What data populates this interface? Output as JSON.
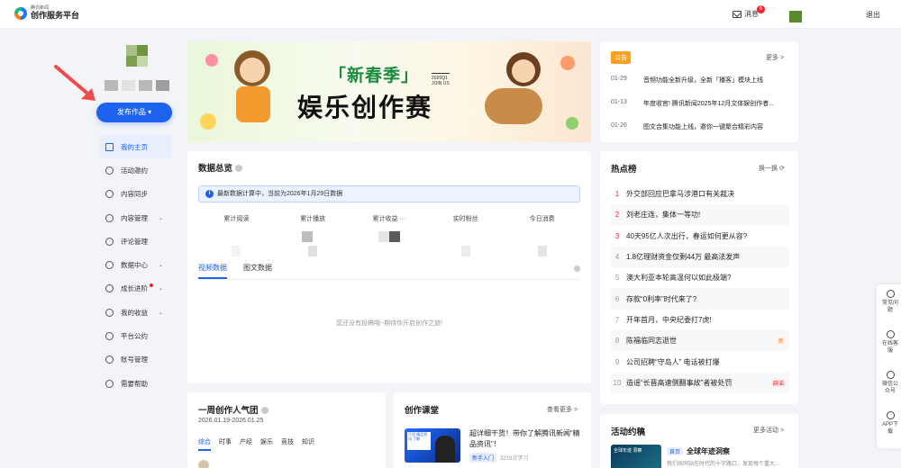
{
  "header": {
    "logo_small": "腾讯新闻",
    "logo_main": "创作服务平台",
    "messages_label": "消息",
    "messages_count": "6",
    "logout_label": "退出"
  },
  "sidebar": {
    "publish_label": "发布作品 ▾",
    "items": [
      {
        "label": "我的主页",
        "icon": "home-icon",
        "active": true
      },
      {
        "label": "活动邀约",
        "icon": "activity-icon"
      },
      {
        "label": "内容同步",
        "icon": "sync-icon"
      },
      {
        "label": "内容管理",
        "icon": "content-icon",
        "expand": true
      },
      {
        "label": "评论管理",
        "icon": "comment-icon"
      },
      {
        "label": "数据中心",
        "icon": "data-icon",
        "expand": true
      },
      {
        "label": "成长进阶",
        "icon": "growth-icon",
        "expand": true,
        "dot": true
      },
      {
        "label": "我的收益",
        "icon": "income-icon",
        "expand": true
      },
      {
        "label": "平台公约",
        "icon": "rules-icon"
      },
      {
        "label": "账号管理",
        "icon": "account-icon"
      },
      {
        "label": "需要帮助",
        "icon": "help-icon"
      }
    ]
  },
  "banner": {
    "title_small": "新春季",
    "title_big": "娱乐创作赛",
    "quarter": "2026Q1",
    "join": "JOIN US"
  },
  "overview": {
    "title": "数据总览",
    "notice": "最新数据计算中，当前为2026年1月29日数据",
    "stats": [
      "累计阅读",
      "累计播放",
      "累计收益 ···",
      "实时粉丝",
      "今日消费"
    ],
    "tabs": [
      "视频数据",
      "图文数据"
    ],
    "empty": "您还没有投稿哦~期待你开启创作之旅!"
  },
  "week": {
    "title": "一周创作人气团",
    "date": "2026.01.19-2026.01.25",
    "tabs": [
      "综合",
      "时事",
      "产经",
      "娱乐",
      "竞技",
      "知识"
    ]
  },
  "course": {
    "title": "创作课堂",
    "more": "查看更多 >",
    "item_title": "超详细干货！带你了解腾讯新闻“精品资讯”！",
    "item_tag": "新手入门",
    "item_count": "3219次学习",
    "thumb_text": "干货 精品资讯 了解"
  },
  "announce": {
    "tag": "公告",
    "more": "更多 >",
    "items": [
      {
        "date": "01-29",
        "text": "音频功能全新升级，全新「播客」模块上线"
      },
      {
        "date": "01-13",
        "text": "年度收官! 腾讯新闻2025年12月文体娱创作者..."
      },
      {
        "date": "01-26",
        "text": "图文合集功能上线，邀你一键聚合精彩内容"
      }
    ]
  },
  "hot": {
    "title": "热点榜",
    "refresh": "换一换 ⟳",
    "items": [
      {
        "rank": "1",
        "text": "外交部回应巴拿马涉港口有关裁决",
        "top": true
      },
      {
        "rank": "2",
        "text": "刘老庄连，集体一等功!",
        "top": true
      },
      {
        "rank": "3",
        "text": "40天95亿人次出行，春运如何更从容?",
        "top": true
      },
      {
        "rank": "4",
        "text": "1.8亿理财资金仅剩44万 最高法发声"
      },
      {
        "rank": "5",
        "text": "澳大利亚本轮高温何以如此极端?"
      },
      {
        "rank": "6",
        "text": "存款“0利率”时代来了?"
      },
      {
        "rank": "7",
        "text": "开年首月，中央纪委打7虎!"
      },
      {
        "rank": "8",
        "text": "陈福临同志逝世",
        "tag": "新",
        "tag_type": "new"
      },
      {
        "rank": "9",
        "text": "公司招聘“守岛人” 电话被打爆"
      },
      {
        "rank": "10",
        "text": "造谣“长晋高速侧翻事故”者被处罚",
        "tag": "辟谣",
        "tag_type": "disc"
      }
    ]
  },
  "activity": {
    "title": "活动约稿",
    "more": "更多活动 >",
    "tag": "首页",
    "item_title": "全球年迹洞察",
    "item_desc": "我们共同站在时代的十字路口，发现每个重大...",
    "thumb_text": "全球年迹 洞察"
  },
  "float": [
    {
      "label": "常见问题",
      "icon": "question-icon"
    },
    {
      "label": "在线客服",
      "icon": "headset-icon"
    },
    {
      "label": "微信公众号",
      "icon": "wechat-icon"
    },
    {
      "label": "APP下载",
      "icon": "app-icon"
    }
  ],
  "colors": {
    "primary": "#1e62f0",
    "accent": "#ff9f1a",
    "hot": "#f5222d"
  }
}
